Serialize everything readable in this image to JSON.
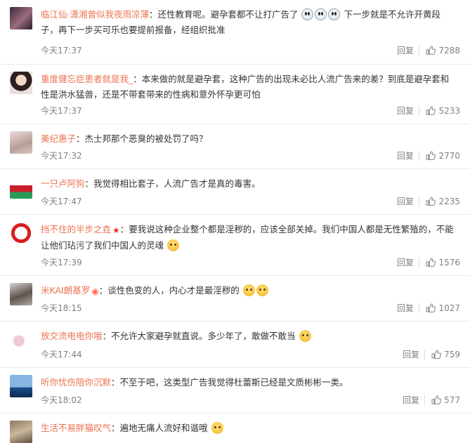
{
  "reply_label": "回复",
  "colors": {
    "username": "#eb7350",
    "meta": "#808080",
    "divider": "#e8e8e8"
  },
  "comments": [
    {
      "user": "临江仙·潇湘曾似我夜雨凉薄",
      "badge": "",
      "text_lines": [
        "：还性教育呢。避孕套都不让打广告了",
        "下一步就是不允许开黄段",
        "子，再下一步买可乐也要提前报备，经组织批准"
      ],
      "emojis": [
        "doge-icon",
        "doge-icon",
        "doge-icon"
      ],
      "time": "今天17:37",
      "likes": "7288"
    },
    {
      "user": "重度健忘症患者就是我_",
      "badge": "",
      "text_lines": [
        "：本来做的就是避孕套，这种广告的出现未必比人流广告来的差？到底是避孕套和",
        "性是洪水猛兽，还是不带套带来的性病和意外怀孕更可怕"
      ],
      "emojis": [],
      "time": "今天17:37",
      "likes": "5233"
    },
    {
      "user": "美纪惠子",
      "badge": "",
      "text_lines": [
        "：杰士邦那个恶臭的被处罚了吗？"
      ],
      "emojis": [],
      "time": "今天17:32",
      "likes": "2770"
    },
    {
      "user": "一只卢阿狗",
      "badge": "",
      "text_lines": [
        "：我觉得相比套子，人流广告才是真的毒害。"
      ],
      "emojis": [],
      "time": "今天17:47",
      "likes": "2235"
    },
    {
      "user": "挡不住的半步之垚",
      "badge": "★",
      "text_lines": [
        "：要我说这种企业整个都是淫秽的，应该全部关掉。我们中国人都是无性繁殖的，不能",
        "让他们玷污了我们中国人的灵魂"
      ],
      "emojis": [
        "cute-face-icon"
      ],
      "time": "今天17:39",
      "likes": "1576"
    },
    {
      "user": "米KAI朗基罗",
      "badge": "◉",
      "text_lines": [
        "：谈性色变的人，内心才是最淫秽的"
      ],
      "emojis": [
        "smirk-icon",
        "smirk-icon"
      ],
      "time": "今天18:15",
      "likes": "1027"
    },
    {
      "user": "放交流电电你哦",
      "badge": "",
      "text_lines": [
        "：不允许大家避孕就直说。多少年了，敢做不敢当"
      ],
      "emojis": [
        "giggle-icon"
      ],
      "time": "今天17:44",
      "likes": "759"
    },
    {
      "user": "听你忧伤陪你沉默",
      "badge": "",
      "text_lines": [
        "：不至于吧，这类型广告我觉得杜蕾斯已经是文质彬彬一类。"
      ],
      "emojis": [],
      "time": "今天18:02",
      "likes": "577"
    },
    {
      "user": "生活不易胖猫叹气",
      "badge": "",
      "text_lines": [
        "：遍地无痛人流好和谐哦"
      ],
      "emojis": [
        "shocked-icon"
      ],
      "time": "",
      "likes": ""
    }
  ]
}
